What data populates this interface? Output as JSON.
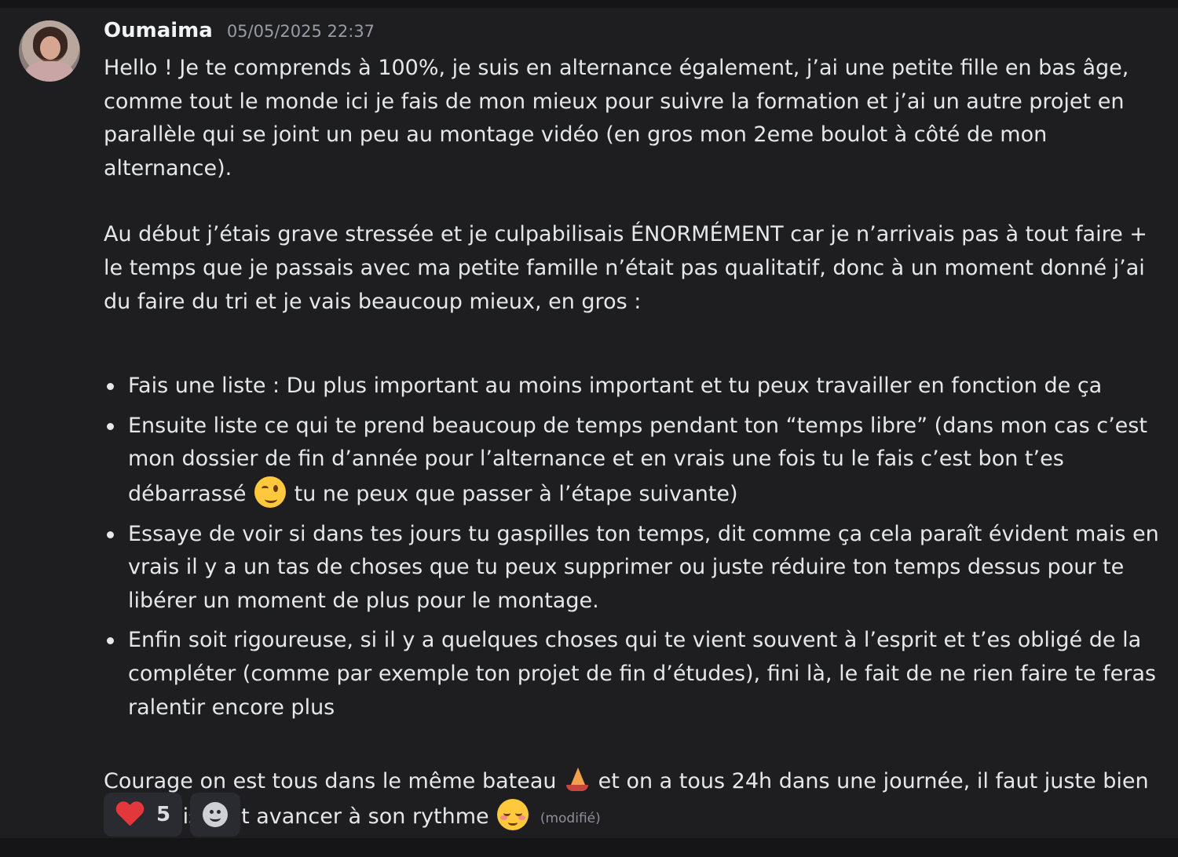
{
  "message": {
    "author": "Oumaima",
    "timestamp": "05/05/2025 22:37",
    "paragraph1": "Hello ! Je te comprends à 100%, je suis en alternance également, j’ai une petite fille en bas âge, comme tout le monde ici je fais de mon mieux pour suivre la formation et j’ai un autre projet en parallèle qui se joint un peu au montage vidéo (en gros mon 2eme boulot à côté de mon alternance).",
    "paragraph2": "Au début j’étais grave stressée et je culpabilisais ÉNORMÉMENT car je n’arrivais pas à tout faire + le temps que je passais avec ma petite famille n’était pas qualitatif, donc à un moment donné j’ai du faire du tri et je vais beaucoup mieux, en gros :",
    "list": {
      "item1": "Fais une liste : Du plus important au moins important et tu peux travailler en fonction de ça",
      "item2_before": "Ensuite liste ce qui te prend beaucoup de temps pendant ton “temps libre” (dans mon cas c’est mon dossier de fin d’année pour l’alternance et en vrais une fois tu le fais c’est bon t’es débarrassé",
      "item2_after": "tu ne peux que passer à l’étape suivante)",
      "item3": "Essaye de voir si dans tes jours tu gaspilles ton temps, dit comme ça cela paraît évident mais en vrais il y a un tas de choses que tu peux supprimer ou juste réduire ton temps dessus pour te libérer un moment de plus pour le montage.",
      "item4": "Enfin soit rigoureuse, si il y a quelques choses qui te vient souvent à l’esprit et t’es obligé de la compléter (comme par exemple ton projet de fin d’études), fini là, le fait de ne rien faire te feras ralentir encore plus"
    },
    "final_before": "Courage on est tous dans le même bateau",
    "final_middle": "et on a tous 24h dans une journée, il faut juste bien s’organiser et avancer à son rythme",
    "edited_label": "(modifié)",
    "emojis": {
      "wink": "winking-face",
      "sailboat": "sailboat",
      "blush": "smiling-face-blush"
    }
  },
  "reactions": [
    {
      "icon": "heart",
      "count": "5"
    },
    {
      "icon": "add-reaction"
    }
  ]
}
